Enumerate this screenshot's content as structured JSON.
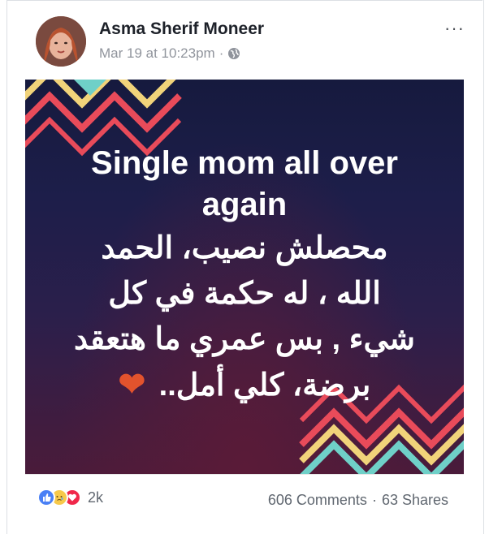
{
  "post": {
    "author": "Asma Sherif Moneer",
    "timestamp": "Mar 19 at 10:23pm",
    "separator": "·",
    "privacy_icon": "globe-icon",
    "more_label": "···"
  },
  "image": {
    "english_lines": [
      "Single mom all over",
      "again"
    ],
    "arabic_lines": [
      "محصلش نصيب، الحمد",
      "الله ، له حكمة في كل",
      "شيء , بس عمري ما هتعقد",
      "برضة، كلي أمل.."
    ],
    "heart_emoji": "❤",
    "colors": {
      "zigzag_red": "#e94b5a",
      "zigzag_yellow": "#f1d37a",
      "zigzag_teal": "#6fd0c8",
      "heart": "#e2532d"
    }
  },
  "footer": {
    "reaction_icons": [
      "like-icon",
      "sad-icon",
      "love-icon"
    ],
    "reaction_count": "2k",
    "comments": "606 Comments",
    "shares": "63 Shares",
    "separator": "·"
  }
}
